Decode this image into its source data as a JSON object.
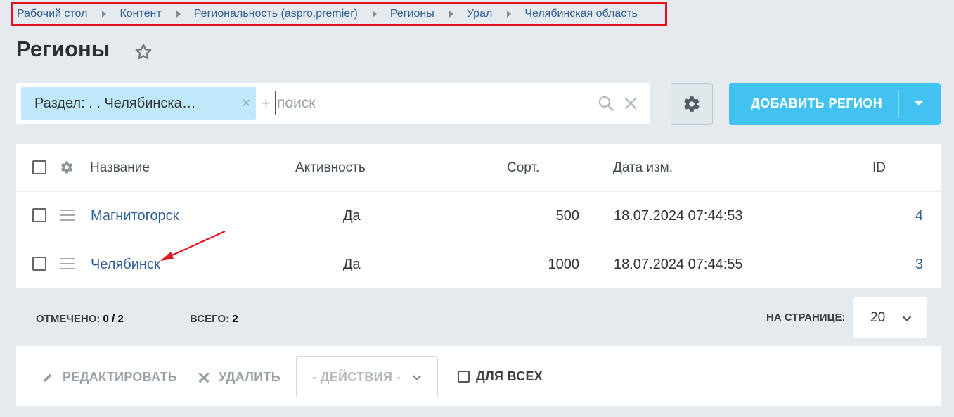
{
  "breadcrumb": [
    "Рабочий стол",
    "Контент",
    "Региональность (aspro.premier)",
    "Регионы",
    "Урал",
    "Челябинская область"
  ],
  "page": {
    "title": "Регионы"
  },
  "filter": {
    "chip_label": "Раздел: . . Челябинска…",
    "chip_close": "×",
    "plus": "+",
    "search_placeholder": "поиск"
  },
  "toolbar": {
    "add_label": "ДОБАВИТЬ РЕГИОН"
  },
  "table": {
    "headers": {
      "name": "Название",
      "active": "Активность",
      "sort": "Сорт.",
      "date": "Дата изм.",
      "id": "ID"
    },
    "rows": [
      {
        "name": "Магнитогорск",
        "active": "Да",
        "sort": "500",
        "date": "18.07.2024 07:44:53",
        "id": "4"
      },
      {
        "name": "Челябинск",
        "active": "Да",
        "sort": "1000",
        "date": "18.07.2024 07:44:55",
        "id": "3"
      }
    ]
  },
  "footer": {
    "selected_label": "ОТМЕЧЕНО:",
    "selected_value": "0 / 2",
    "total_label": "ВСЕГО:",
    "total_value": "2",
    "per_page_label": "НА СТРАНИЦЕ:",
    "per_page_value": "20"
  },
  "actions": {
    "edit": "РЕДАКТИРОВАТЬ",
    "delete": "УДАЛИТЬ",
    "select": "- ДЕЙСТВИЯ -",
    "for_all": "ДЛЯ ВСЕХ"
  },
  "colors": {
    "accent": "#41c2f0",
    "link": "#2f5f94",
    "chip": "#bfe9fb",
    "annotation": "#e3141e"
  }
}
